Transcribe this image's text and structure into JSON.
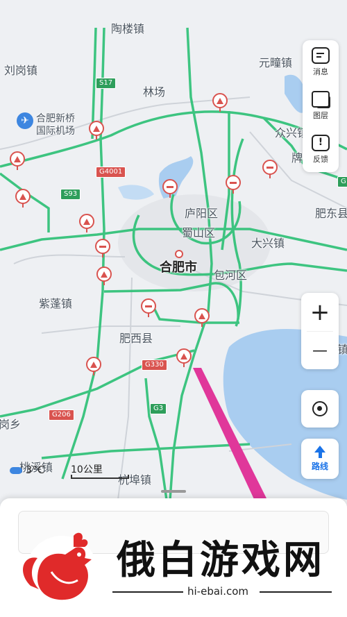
{
  "map": {
    "places": {
      "taolou": "陶楼镇",
      "liugang": "刘岗镇",
      "yuantong": "元疃镇",
      "linchang": "林场",
      "airport_line1": "合肥新桥",
      "airport_line2": "国际机场",
      "zhongxing": "众兴镇",
      "pai": "牌",
      "feidong": "肥东县",
      "luyang": "庐阳区",
      "shushan": "蜀山区",
      "daxing": "大兴镇",
      "hefei": "合肥市",
      "baohe": "包河区",
      "zipeng": "紫蓬镇",
      "feixi": "肥西县",
      "gangxiang": "岗乡",
      "taohu": "桃溪镇",
      "hangbu": "杭埠镇",
      "zhen_right": "镇"
    },
    "road_shields": {
      "s17": "S17",
      "g4001": "G4001",
      "s93": "S93",
      "g330": "G330",
      "g206": "G206",
      "g3": "G3",
      "g5_partial": "G"
    }
  },
  "controls": {
    "message_label": "消息",
    "layers_label": "图层",
    "feedback_label": "反馈",
    "zoom_in": "+",
    "zoom_out": "—",
    "route_label": "路线"
  },
  "scale_text": "10公里",
  "weather_text": "3°C",
  "watermark": {
    "title": "俄白游戏网",
    "url": "hi-ebai.com"
  },
  "colors": {
    "highway": "#34c27a",
    "lake": "#a9cdf0",
    "marker": "#d9534f",
    "route_arrow": "#1a73e8",
    "annotation": "#e0379a"
  }
}
